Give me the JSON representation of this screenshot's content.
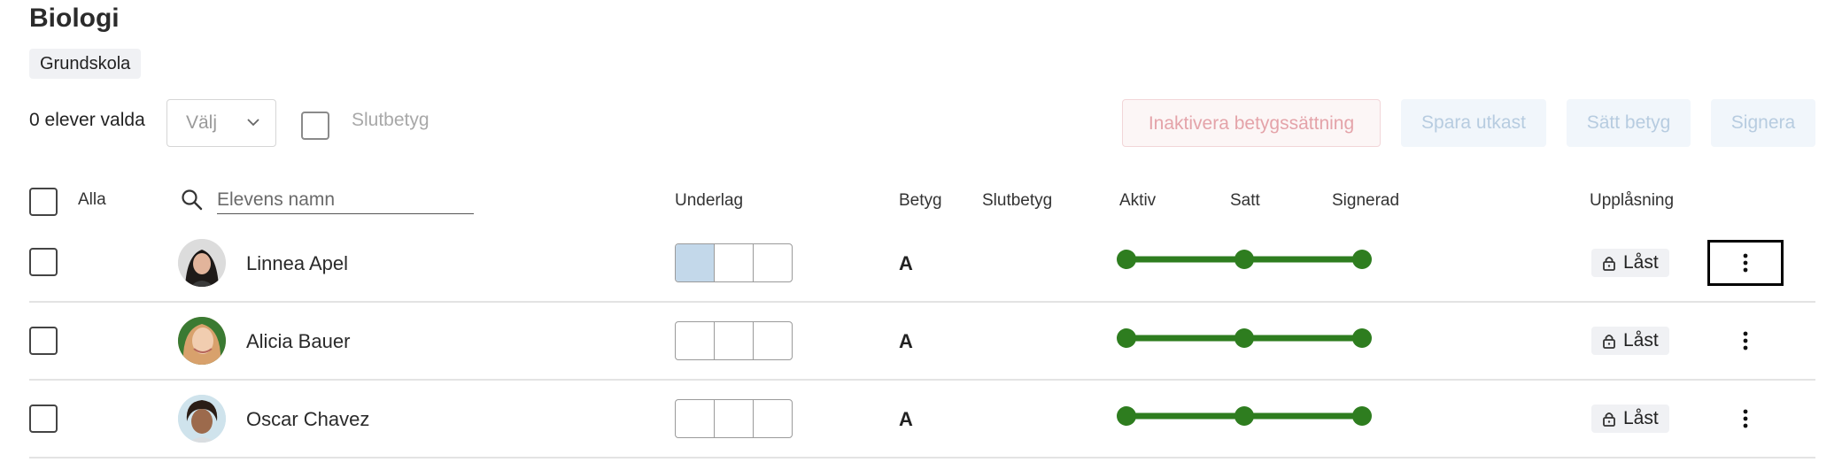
{
  "page": {
    "title": "Biologi",
    "level_badge": "Grundskola"
  },
  "toolbar": {
    "selected_count": "0 elever valda",
    "select_value": "Välj",
    "final_grade_label": "Slutbetyg",
    "buttons": {
      "inactivate": "Inaktivera betygssättning",
      "save_draft": "Spara utkast",
      "set_grade": "Sätt betyg",
      "sign": "Signera"
    }
  },
  "table": {
    "headers": {
      "all": "Alla",
      "underlag": "Underlag",
      "betyg": "Betyg",
      "slutbetyg": "Slutbetyg",
      "aktiv": "Aktiv",
      "satt": "Satt",
      "signerad": "Signerad",
      "upplasning": "Upplåsning"
    },
    "search_placeholder": "Elevens namn",
    "rows": [
      {
        "name": "Linnea Apel",
        "grade": "A",
        "underlag_filled": [
          true,
          false,
          false
        ],
        "lock": "Låst"
      },
      {
        "name": "Alicia Bauer",
        "grade": "A",
        "underlag_filled": [
          false,
          false,
          false
        ],
        "lock": "Låst"
      },
      {
        "name": "Oscar Chavez",
        "grade": "A",
        "underlag_filled": [
          false,
          false,
          false
        ],
        "lock": "Låst"
      }
    ]
  },
  "colors": {
    "status_green": "#2e7d1f",
    "underlag_fill": "#c3d8ea"
  }
}
